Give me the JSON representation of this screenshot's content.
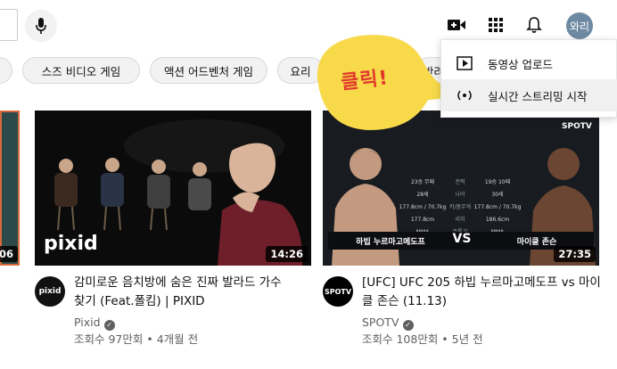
{
  "header": {
    "avatar_label": "와리",
    "icons": [
      "mic-icon",
      "create-video-icon",
      "apps-grid-icon",
      "bell-icon"
    ]
  },
  "chips": [
    {
      "label": "스즈 비디오 게임"
    },
    {
      "label": "액션 어드벤처 게임"
    },
    {
      "label": "요리"
    },
    {
      "label": "반려"
    }
  ],
  "create_menu": {
    "items": [
      {
        "label": "동영상 업로드",
        "icon": "video-upload-icon"
      },
      {
        "label": "실시간 스트리밍 시작",
        "icon": "live-stream-icon"
      }
    ]
  },
  "annotation": {
    "bubble_text": "클릭!",
    "bubble_color": "#f7d94a"
  },
  "videos": [
    {
      "duration": ":06"
    },
    {
      "title": "감미로운 음치방에 숨은 진짜 발라드 가수 찾기 (Feat.폴킴) | PIXID",
      "channel": "Pixid",
      "meta": "조회수 97만회 • 4개월 전",
      "duration": "14:26",
      "thumb_logo": "pixid",
      "channel_avatar_text": "pixid"
    },
    {
      "title": "[UFC] UFC 205 하빕 누르마고메도프 vs 마이클 존슨 (11.13)",
      "channel": "SPOTV",
      "meta": "조회수 108만회 • 5년 전",
      "duration": "27:35",
      "thumb_left_name": "하빕 누르마고메도프",
      "thumb_right_name": "마이클 존슨",
      "thumb_vs": "VS",
      "thumb_watermark": "SPOTV",
      "stat_rows": [
        {
          "left": "23승 무패",
          "label": "전적",
          "right": "19승 10패"
        },
        {
          "left": "28세",
          "label": "나이",
          "right": "30세"
        },
        {
          "left": "177.8cm / 70.7kg",
          "label": "키/몸무게",
          "right": "177.8cm / 70.7kg"
        },
        {
          "left": "177.8cm",
          "label": "리치",
          "right": "186.6cm"
        },
        {
          "left": "MMA",
          "label": "주특기",
          "right": "MMA"
        }
      ],
      "channel_avatar_text": "SPOTV"
    }
  ]
}
